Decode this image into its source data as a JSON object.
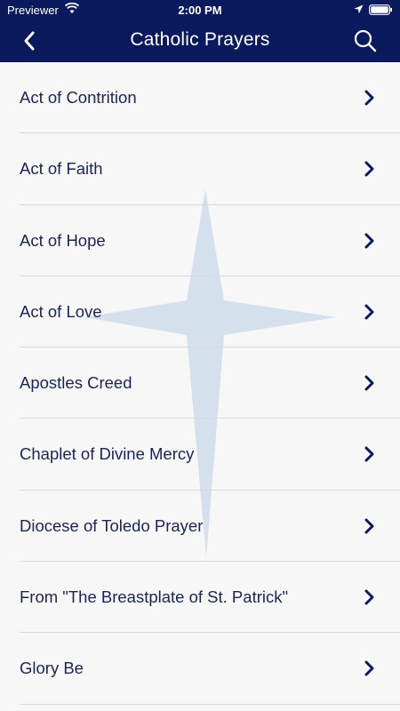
{
  "status_bar": {
    "carrier": "Previewer",
    "time": "2:00 PM",
    "wifi_icon": "wifi-icon",
    "location_icon": "location-arrow-icon",
    "battery_icon": "battery-full-icon"
  },
  "nav": {
    "title": "Catholic Prayers",
    "back_icon": "chevron-left-icon",
    "search_icon": "search-icon"
  },
  "prayers": [
    {
      "label": "Act of Contrition"
    },
    {
      "label": "Act of Faith"
    },
    {
      "label": "Act of Hope"
    },
    {
      "label": "Act of Love"
    },
    {
      "label": "Apostles Creed"
    },
    {
      "label": "Chaplet of Divine Mercy"
    },
    {
      "label": "Diocese of Toledo Prayer"
    },
    {
      "label": "From \"The Breastplate of St. Patrick\""
    },
    {
      "label": "Glory Be"
    }
  ],
  "colors": {
    "header": "#0b1a5c",
    "text": "#1b2550",
    "background": "#f7f7f8",
    "cross_watermark": "#d3deec"
  }
}
